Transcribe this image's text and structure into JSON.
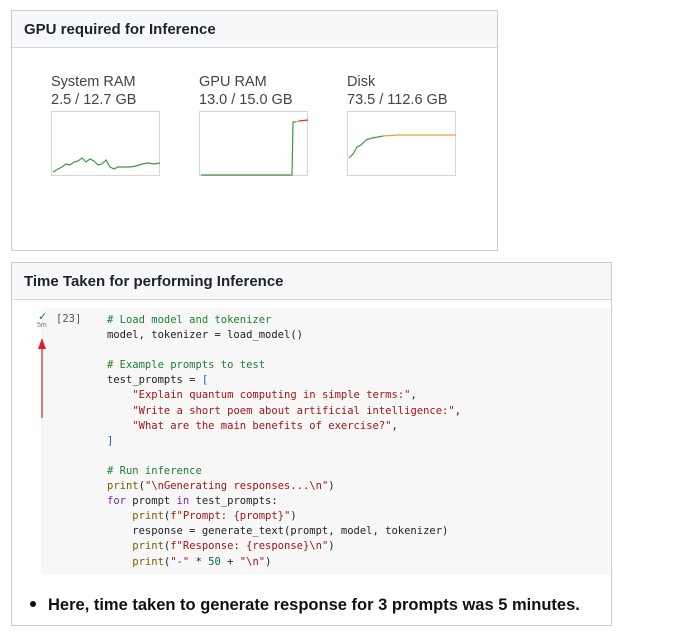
{
  "gpu_card": {
    "title": "GPU required for Inference",
    "resources": [
      {
        "name": "System RAM",
        "usage": "2.5 / 12.7 GB"
      },
      {
        "name": "GPU RAM",
        "usage": "13.0 / 15.0 GB"
      },
      {
        "name": "Disk",
        "usage": "73.5 / 112.6 GB"
      }
    ],
    "colors": {
      "normal": "#3c9a3c",
      "warning": "#f0a030",
      "critical": "#e03030"
    }
  },
  "time_card": {
    "title": "Time Taken for performing Inference",
    "cell": {
      "status_icon": "checkmark-icon",
      "elapsed": "5m",
      "exec_count": "[23]"
    },
    "bullet": "Here, time taken to generate response for 3 prompts was 5 minutes."
  }
}
